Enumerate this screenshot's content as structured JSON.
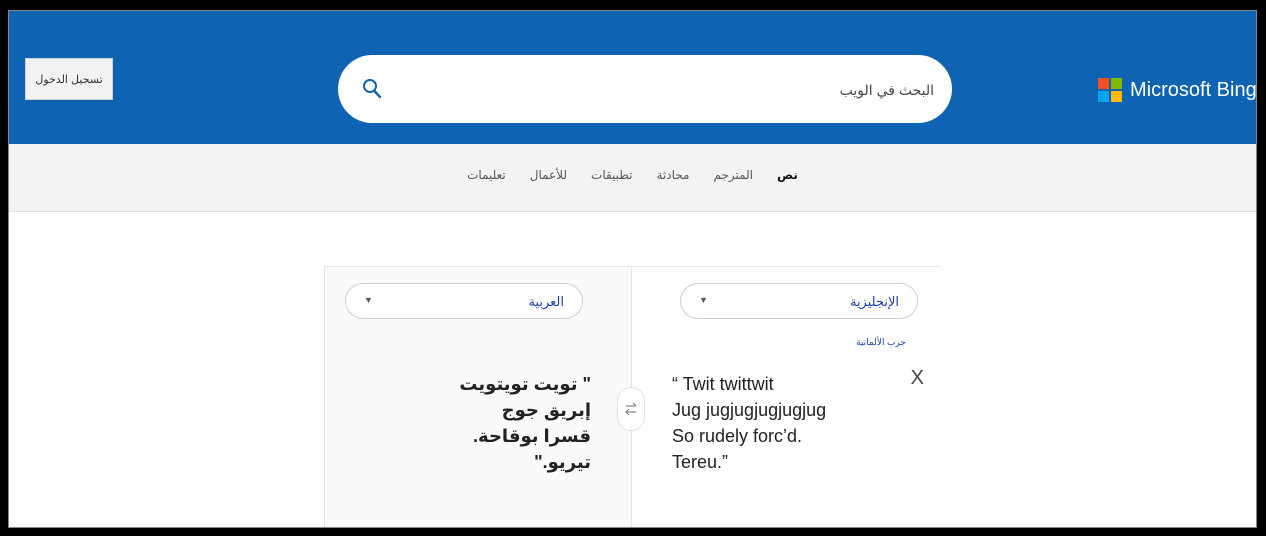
{
  "header": {
    "signin_label": "تسجيل الدخول",
    "search_placeholder": "البحث في الويب",
    "search_icon": "search-icon",
    "brand": "Microsoft Bing",
    "bg_color": "#0e64b3"
  },
  "nav": {
    "items": [
      {
        "label": "نص",
        "active": true
      },
      {
        "label": "المترجم",
        "active": false
      },
      {
        "label": "محادثة",
        "active": false
      },
      {
        "label": "تطبيقات",
        "active": false
      },
      {
        "label": "للأعمال",
        "active": false
      },
      {
        "label": "تعليمات",
        "active": false
      }
    ]
  },
  "translator": {
    "source_lang": "الإنجليزية",
    "target_lang": "العربية",
    "try_hint": "جرب الألمانية",
    "clear_label": "X",
    "source_lines": [
      "“ Twit twittwit",
      "Jug  jugjugjugjugjug",
      "So rudely forc’d.",
      "Tereu.”"
    ],
    "target_lines": [
      "\" تويت تويتويت",
      "إبريق جوج",
      "قسرا بوقاحة.",
      "تيريو.\""
    ],
    "swap_icon": "swap-arrows-icon"
  },
  "colors": {
    "accent_link": "#1a3da8",
    "logo": [
      "#f25022",
      "#7fba00",
      "#00a4ef",
      "#ffb900"
    ]
  }
}
